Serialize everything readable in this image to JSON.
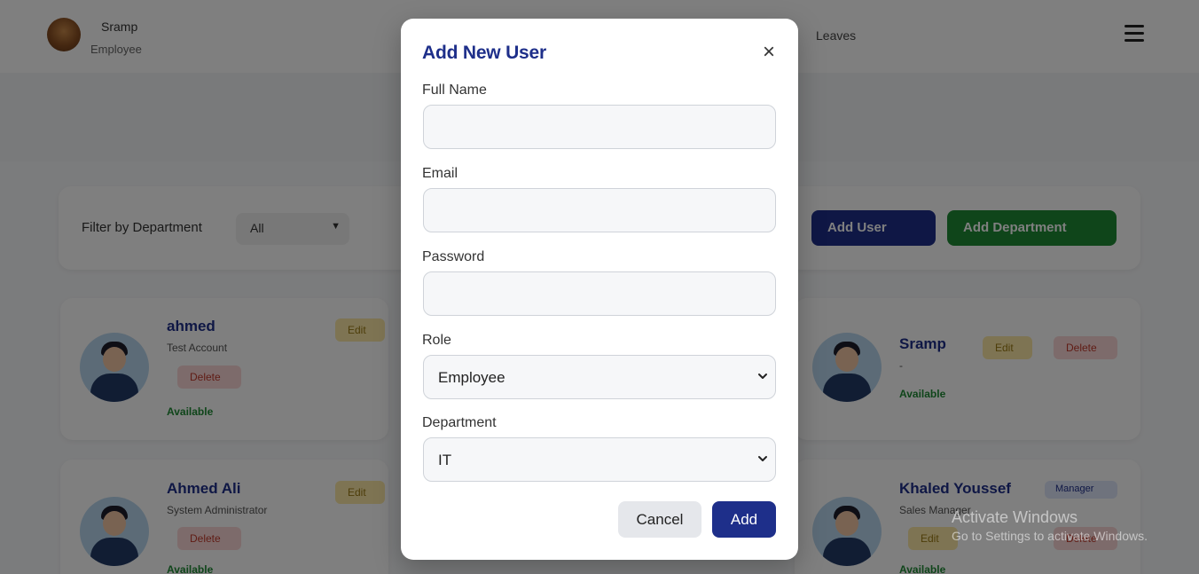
{
  "header": {
    "profile_name": "Sramp",
    "profile_role": "Employee",
    "nav_link": "Leaves"
  },
  "filter": {
    "label": "Filter by Department",
    "selected": "All",
    "add_user_label": "Add User",
    "add_department_label": "Add Department"
  },
  "users": [
    {
      "name": "ahmed",
      "title": "Test Account",
      "edit_label": "Edit",
      "delete_label": "Delete",
      "status": "Available"
    },
    {
      "name": "Sramp",
      "title": "-",
      "edit_label": "Edit",
      "delete_label": "Delete",
      "status": "Available"
    },
    {
      "name": "Ahmed Ali",
      "title": "System Administrator",
      "edit_label": "Edit",
      "delete_label": "Delete",
      "status": "Available"
    },
    {
      "name": "Khaled Youssef",
      "title": "Sales Manager",
      "badge": "Manager",
      "edit_label": "Edit",
      "delete_label": "Delete",
      "status": "Available"
    }
  ],
  "modal": {
    "title": "Add New User",
    "close_symbol": "×",
    "full_name_label": "Full Name",
    "full_name_value": "",
    "email_label": "Email",
    "email_value": "",
    "password_label": "Password",
    "password_value": "",
    "role_label": "Role",
    "role_selected": "Employee",
    "department_label": "Department",
    "department_selected": "IT",
    "cancel_label": "Cancel",
    "add_label": "Add"
  },
  "watermark": {
    "title": "Activate Windows",
    "subtitle": "Go to Settings to activate Windows."
  },
  "colors": {
    "brand_blue": "#1e2f8a",
    "brand_green": "#1e8a34"
  },
  "icons": {
    "close": "close-icon",
    "menu": "menu-icon",
    "select_chevron": "chevron-down-icon"
  }
}
